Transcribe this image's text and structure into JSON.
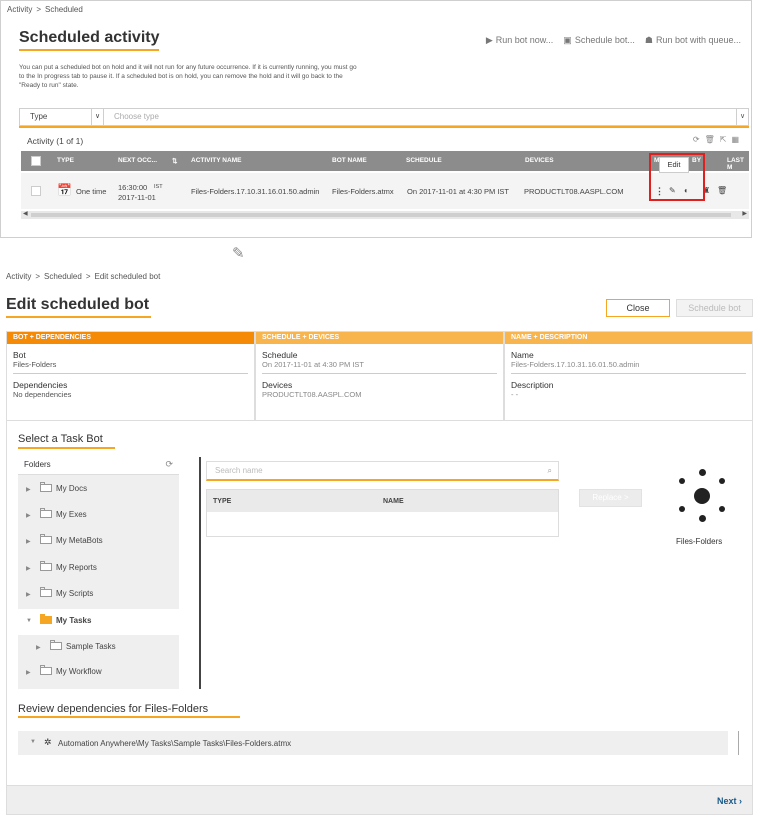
{
  "top": {
    "breadcrumb": [
      "Activity",
      "Scheduled"
    ],
    "breadcrumb_sep": ">",
    "title": "Scheduled activity",
    "actions": {
      "run_now": "Run bot now...",
      "schedule": "Schedule bot...",
      "run_queue": "Run bot with queue..."
    },
    "description": "You can put a scheduled bot on hold and it will not run for any future occurrence. If it is currently running, you must go to the In progress tab to pause it. If a scheduled bot is on hold, you can remove the hold and it will go back to the \"Ready to run\" state.",
    "filter": {
      "type_label": "Type",
      "choose_placeholder": "Choose type"
    },
    "activity_count": "Activity (1 of 1)",
    "columns": {
      "type": "TYPE",
      "next_occ": "NEXT OCC...",
      "activity_name": "ACTIVITY NAME",
      "bot_name": "BOT NAME",
      "schedule": "SCHEDULE",
      "devices": "DEVICES",
      "m": "M",
      "by": "BY",
      "last": "LAST M"
    },
    "row": {
      "type": "One time",
      "next_time": "16:30:00",
      "next_tz": "IST",
      "next_date": "2017-11-01",
      "activity_name": "Files-Folders.17.10.31.16.01.50.admin",
      "bot_name": "Files-Folders.atmx",
      "schedule": "On 2017-11-01 at 4:30 PM IST",
      "devices": "PRODUCTLT08.AASPL.COM"
    },
    "tooltip": "Edit"
  },
  "bottom": {
    "breadcrumb": [
      "Activity",
      "Scheduled",
      "Edit scheduled bot"
    ],
    "breadcrumb_sep": ">",
    "title": "Edit scheduled bot",
    "close_label": "Close",
    "schedule_label": "Schedule bot",
    "steps": {
      "s1": {
        "header": "BOT + DEPENDENCIES",
        "bot_label": "Bot",
        "bot_value": "Files-Folders",
        "dep_label": "Dependencies",
        "dep_value": "No dependencies"
      },
      "s2": {
        "header": "SCHEDULE + DEVICES",
        "schedule_label": "Schedule",
        "schedule_value": "On 2017-11-01 at 4:30 PM IST",
        "devices_label": "Devices",
        "devices_value": "PRODUCTLT08.AASPL.COM"
      },
      "s3": {
        "header": "NAME + DESCRIPTION",
        "name_label": "Name",
        "name_value": "Files-Folders.17.10.31.16.01.50.admin",
        "desc_label": "Description",
        "desc_value": "- -"
      }
    },
    "select_title": "Select a Task Bot",
    "folders_header": "Folders",
    "folders": [
      "My Docs",
      "My Exes",
      "My MetaBots",
      "My Reports",
      "My Scripts",
      "My Tasks",
      "Sample Tasks",
      "My Workflow"
    ],
    "search_placeholder": "Search name",
    "table_type": "TYPE",
    "table_name": "NAME",
    "replace_label": "Replace >",
    "bot_caption": "Files-Folders",
    "review_title": "Review dependencies for Files-Folders",
    "dep_path": "Automation Anywhere\\My Tasks\\Sample Tasks\\Files-Folders.atmx",
    "next_label": "Next"
  },
  "colors": {
    "accent": "#f5a623",
    "step_active": "#f58a07",
    "step_inactive": "#f8b54e",
    "grid_header": "#8c8c8c",
    "highlight": "#e01f1f",
    "next_link": "#1a5a8a"
  }
}
